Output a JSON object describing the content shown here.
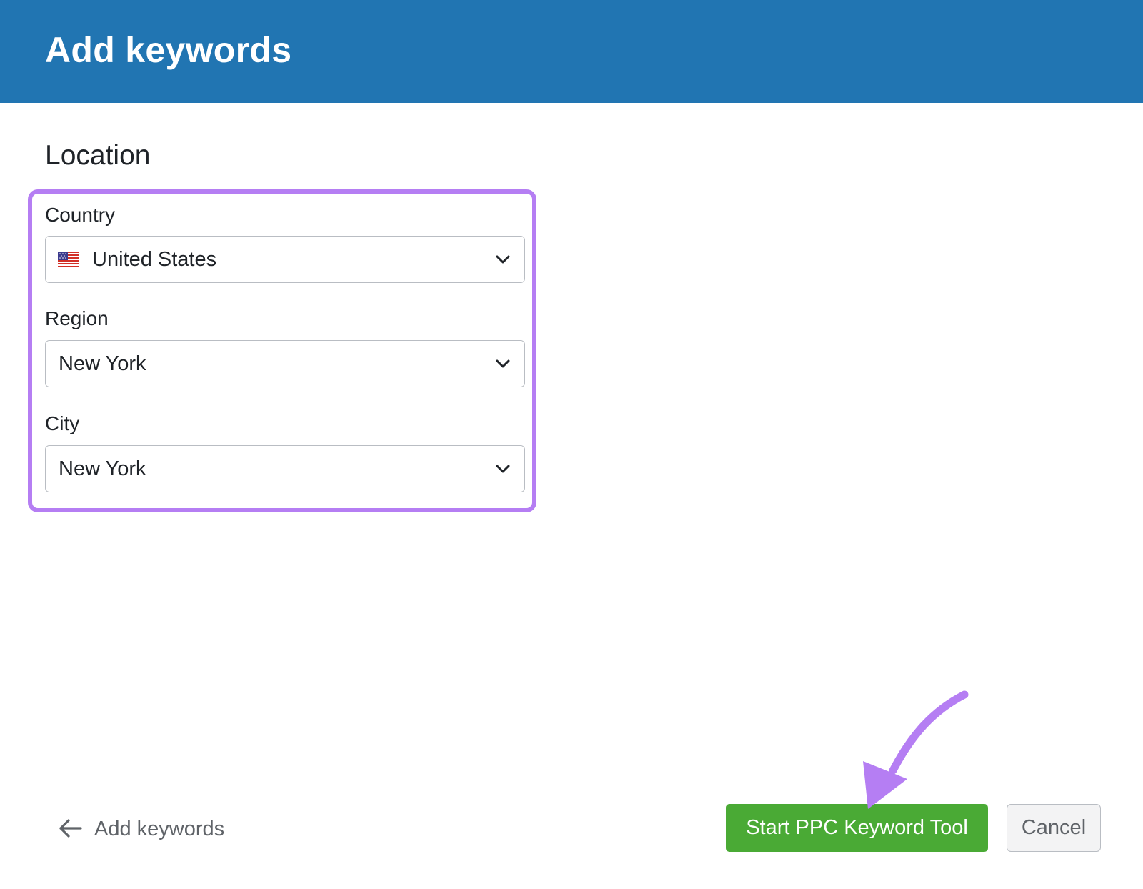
{
  "header": {
    "title": "Add keywords",
    "background_color": "#2175b2"
  },
  "location": {
    "section_title": "Location",
    "highlight_color": "#b57ef3",
    "country": {
      "label": "Country",
      "value": "United States",
      "flag_icon": "us-flag-icon"
    },
    "region": {
      "label": "Region",
      "value": "New York"
    },
    "city": {
      "label": "City",
      "value": "New York"
    }
  },
  "footer": {
    "back_label": "Add keywords",
    "start_button_label": "Start PPC Keyword Tool",
    "start_button_color": "#4aaa35",
    "cancel_button_label": "Cancel"
  },
  "annotation": {
    "arrow_icon": "curved-arrow-icon",
    "arrow_color": "#b57ef3"
  }
}
